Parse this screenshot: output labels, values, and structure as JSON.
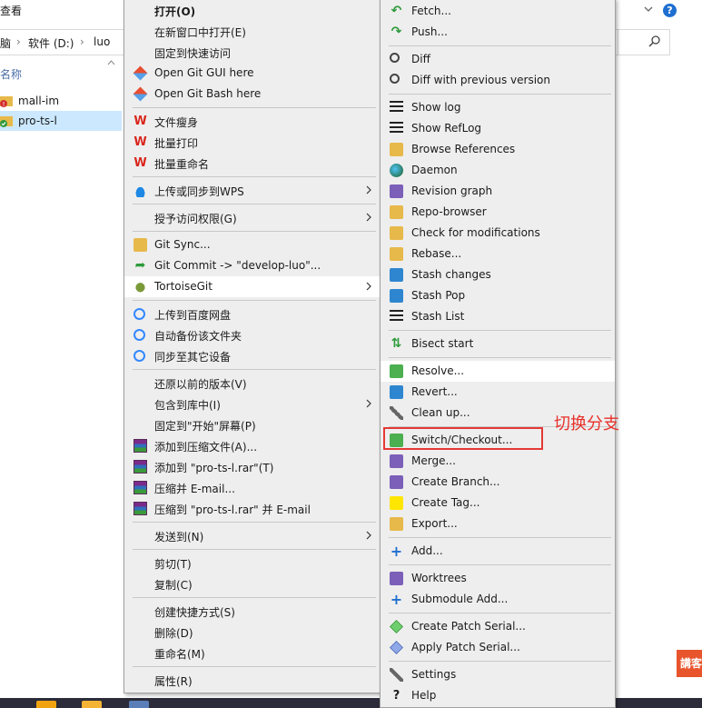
{
  "explorer": {
    "ribbon_tab": "查看",
    "breadcrumb": [
      "脑",
      "软件 (D:)",
      "luo"
    ],
    "column_header": "名称",
    "files": [
      {
        "name": "mall-im",
        "status": "modified"
      },
      {
        "name": "pro-ts-l",
        "status": "normal",
        "selected": true
      }
    ],
    "promo_text": "講客"
  },
  "context_menu": {
    "items": [
      {
        "label": "打开(O)",
        "icon": "none",
        "bold": true
      },
      {
        "label": "在新窗口中打开(E)",
        "icon": "none"
      },
      {
        "label": "固定到快速访问",
        "icon": "none"
      },
      {
        "label": "Open Git GUI here",
        "icon": "git-icon"
      },
      {
        "label": "Open Git Bash here",
        "icon": "git-icon"
      },
      {
        "label": "文件瘦身",
        "icon": "wps-icon"
      },
      {
        "label": "批量打印",
        "icon": "wps-icon"
      },
      {
        "label": "批量重命名",
        "icon": "wps-icon"
      },
      {
        "label": "上传或同步到WPS",
        "icon": "cloud-icon",
        "submenu": true
      },
      {
        "label": "授予访问权限(G)",
        "icon": "none",
        "submenu": true
      },
      {
        "label": "Git Sync...",
        "icon": "git-sync-icon"
      },
      {
        "label": "Git Commit -> \"develop-luo\"...",
        "icon": "git-commit-icon"
      },
      {
        "label": "TortoiseGit",
        "icon": "tortoisegit-icon",
        "submenu": true,
        "highlighted": true
      },
      {
        "label": "上传到百度网盘",
        "icon": "baidu-icon"
      },
      {
        "label": "自动备份该文件夹",
        "icon": "baidu-icon"
      },
      {
        "label": "同步至其它设备",
        "icon": "baidu-icon"
      },
      {
        "label": "还原以前的版本(V)",
        "icon": "none"
      },
      {
        "label": "包含到库中(I)",
        "icon": "none",
        "submenu": true
      },
      {
        "label": "固定到\"开始\"屏幕(P)",
        "icon": "none"
      },
      {
        "label": "添加到压缩文件(A)...",
        "icon": "rar-icon"
      },
      {
        "label": "添加到 \"pro-ts-l.rar\"(T)",
        "icon": "rar-icon"
      },
      {
        "label": "压缩并 E-mail...",
        "icon": "rar-icon"
      },
      {
        "label": "压缩到 \"pro-ts-l.rar\" 并 E-mail",
        "icon": "rar-icon"
      },
      {
        "label": "发送到(N)",
        "icon": "none",
        "submenu": true
      },
      {
        "label": "剪切(T)",
        "icon": "none"
      },
      {
        "label": "复制(C)",
        "icon": "none"
      },
      {
        "label": "创建快捷方式(S)",
        "icon": "none"
      },
      {
        "label": "删除(D)",
        "icon": "none"
      },
      {
        "label": "重命名(M)",
        "icon": "none"
      },
      {
        "label": "属性(R)",
        "icon": "none"
      }
    ]
  },
  "tortoisegit_menu": {
    "items": [
      {
        "label": "Fetch...",
        "icon": "fetch-icon"
      },
      {
        "label": "Push...",
        "icon": "push-icon"
      },
      {
        "label": "Diff",
        "icon": "diff-icon"
      },
      {
        "label": "Diff with previous version",
        "icon": "diff-icon"
      },
      {
        "label": "Show log",
        "icon": "log-icon"
      },
      {
        "label": "Show RefLog",
        "icon": "log-icon"
      },
      {
        "label": "Browse References",
        "icon": "references-icon"
      },
      {
        "label": "Daemon",
        "icon": "globe-icon"
      },
      {
        "label": "Revision graph",
        "icon": "graph-icon"
      },
      {
        "label": "Repo-browser",
        "icon": "repo-browser-icon"
      },
      {
        "label": "Check for modifications",
        "icon": "check-icon"
      },
      {
        "label": "Rebase...",
        "icon": "rebase-icon"
      },
      {
        "label": "Stash changes",
        "icon": "stash-icon"
      },
      {
        "label": "Stash Pop",
        "icon": "stash-icon"
      },
      {
        "label": "Stash List",
        "icon": "log-icon"
      },
      {
        "label": "Bisect start",
        "icon": "bisect-icon"
      },
      {
        "label": "Resolve...",
        "icon": "resolve-icon",
        "highlighted": true
      },
      {
        "label": "Revert...",
        "icon": "revert-icon"
      },
      {
        "label": "Clean up...",
        "icon": "cleanup-icon"
      },
      {
        "label": "Switch/Checkout...",
        "icon": "switch-icon"
      },
      {
        "label": "Merge...",
        "icon": "merge-icon"
      },
      {
        "label": "Create Branch...",
        "icon": "branch-icon"
      },
      {
        "label": "Create Tag...",
        "icon": "tag-icon"
      },
      {
        "label": "Export...",
        "icon": "export-icon"
      },
      {
        "label": "Add...",
        "icon": "add-icon"
      },
      {
        "label": "Worktrees",
        "icon": "worktree-icon"
      },
      {
        "label": "Submodule Add...",
        "icon": "add-icon"
      },
      {
        "label": "Create Patch Serial...",
        "icon": "patch-icon"
      },
      {
        "label": "Apply Patch Serial...",
        "icon": "apply-patch-icon"
      },
      {
        "label": "Settings",
        "icon": "settings-icon"
      },
      {
        "label": "Help",
        "icon": "help-icon"
      }
    ]
  },
  "annotation": {
    "text": "切换分支",
    "color": "#e8302a"
  },
  "colors": {
    "menu_bg": "#eeeeee",
    "highlight": "#ffffff",
    "selection": "#cce8ff",
    "annotation_box": "#e53935"
  }
}
